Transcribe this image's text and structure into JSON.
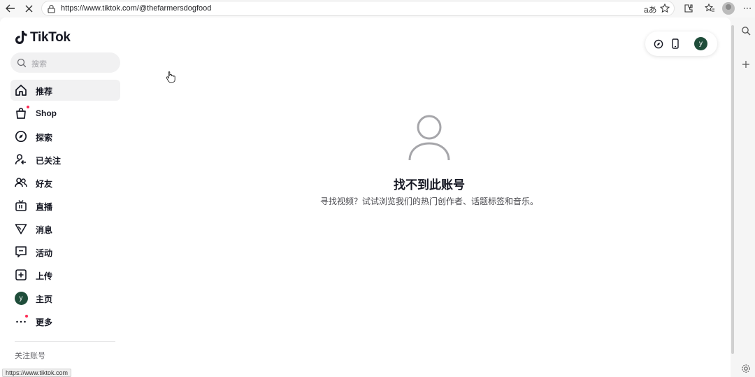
{
  "browser": {
    "url": "https://www.tiktok.com/@thefarmersdogfood",
    "status_url": "https://www.tiktok.com"
  },
  "sidebar": {
    "logo_text": "TikTok",
    "search_placeholder": "搜索",
    "items": [
      {
        "label": "推荐",
        "icon": "home-icon",
        "active": true
      },
      {
        "label": "Shop",
        "icon": "shopping-bag-icon"
      },
      {
        "label": "探索",
        "icon": "compass-icon"
      },
      {
        "label": "已关注",
        "icon": "following-icon"
      },
      {
        "label": "好友",
        "icon": "friends-icon"
      },
      {
        "label": "直播",
        "icon": "live-tv-icon"
      },
      {
        "label": "消息",
        "icon": "send-icon"
      },
      {
        "label": "活动",
        "icon": "activity-icon"
      },
      {
        "label": "上传",
        "icon": "upload-plus-icon"
      },
      {
        "label": "主页",
        "icon": "avatar"
      },
      {
        "label": "更多",
        "icon": "more-icon"
      }
    ],
    "avatar_letter": "y",
    "following_accounts_title": "关注账号"
  },
  "topbar": {
    "avatar_letter": "y"
  },
  "main": {
    "title": "找不到此账号",
    "subtitle": "寻找视频？试试浏览我们的热门创作者、话题标签和音乐。"
  },
  "colors": {
    "avatar_bg": "#1f4d3a",
    "accent_red": "#fe2c55"
  }
}
